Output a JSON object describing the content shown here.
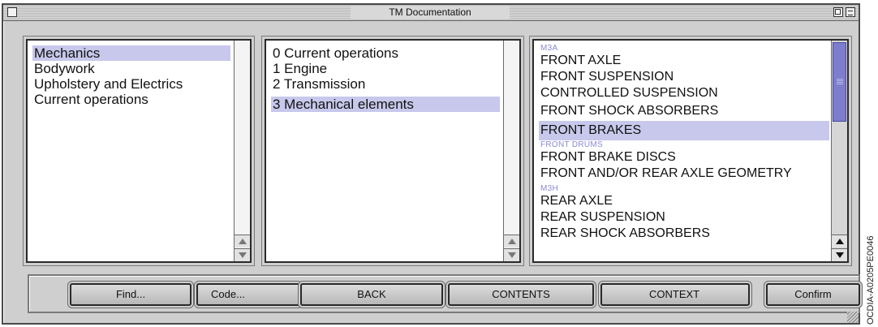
{
  "window": {
    "title": "TM Documentation"
  },
  "left_list": {
    "items": [
      {
        "label": "Mechanics",
        "selected": true
      },
      {
        "label": "Bodywork",
        "selected": false
      },
      {
        "label": "Upholstery and Electrics",
        "selected": false
      },
      {
        "label": "Current operations",
        "selected": false
      }
    ]
  },
  "middle_list": {
    "items": [
      {
        "label": "0 Current operations",
        "selected": false
      },
      {
        "label": "1 Engine",
        "selected": false
      },
      {
        "label": "2 Transmission",
        "selected": false
      },
      {
        "label": "3 Mechanical elements",
        "selected": true
      }
    ]
  },
  "right_list": {
    "sections": [
      "M3A",
      "FRONT DRUMS",
      "M3H"
    ],
    "items": [
      "FRONT AXLE",
      "FRONT SUSPENSION",
      "CONTROLLED SUSPENSION",
      "FRONT SHOCK ABSORBERS",
      "FRONT BRAKES",
      "FRONT BRAKE DISCS",
      "FRONT AND/OR REAR AXLE GEOMETRY",
      "REAR AXLE",
      "REAR SUSPENSION",
      "REAR SHOCK ABSORBERS"
    ],
    "selected_item": "FRONT BRAKES"
  },
  "buttons": {
    "find": "Find...",
    "code": "Code...",
    "back": "BACK",
    "contents": "CONTENTS",
    "context": "CONTEXT",
    "confirm": "Confirm"
  },
  "watermark": "OCDIA-A0205PE0046",
  "colors": {
    "selection": "#c8c8ec",
    "section_label": "#8a8ad2",
    "scroll_thumb": "#7d7dcc",
    "window_bg": "#cfcfcf"
  }
}
